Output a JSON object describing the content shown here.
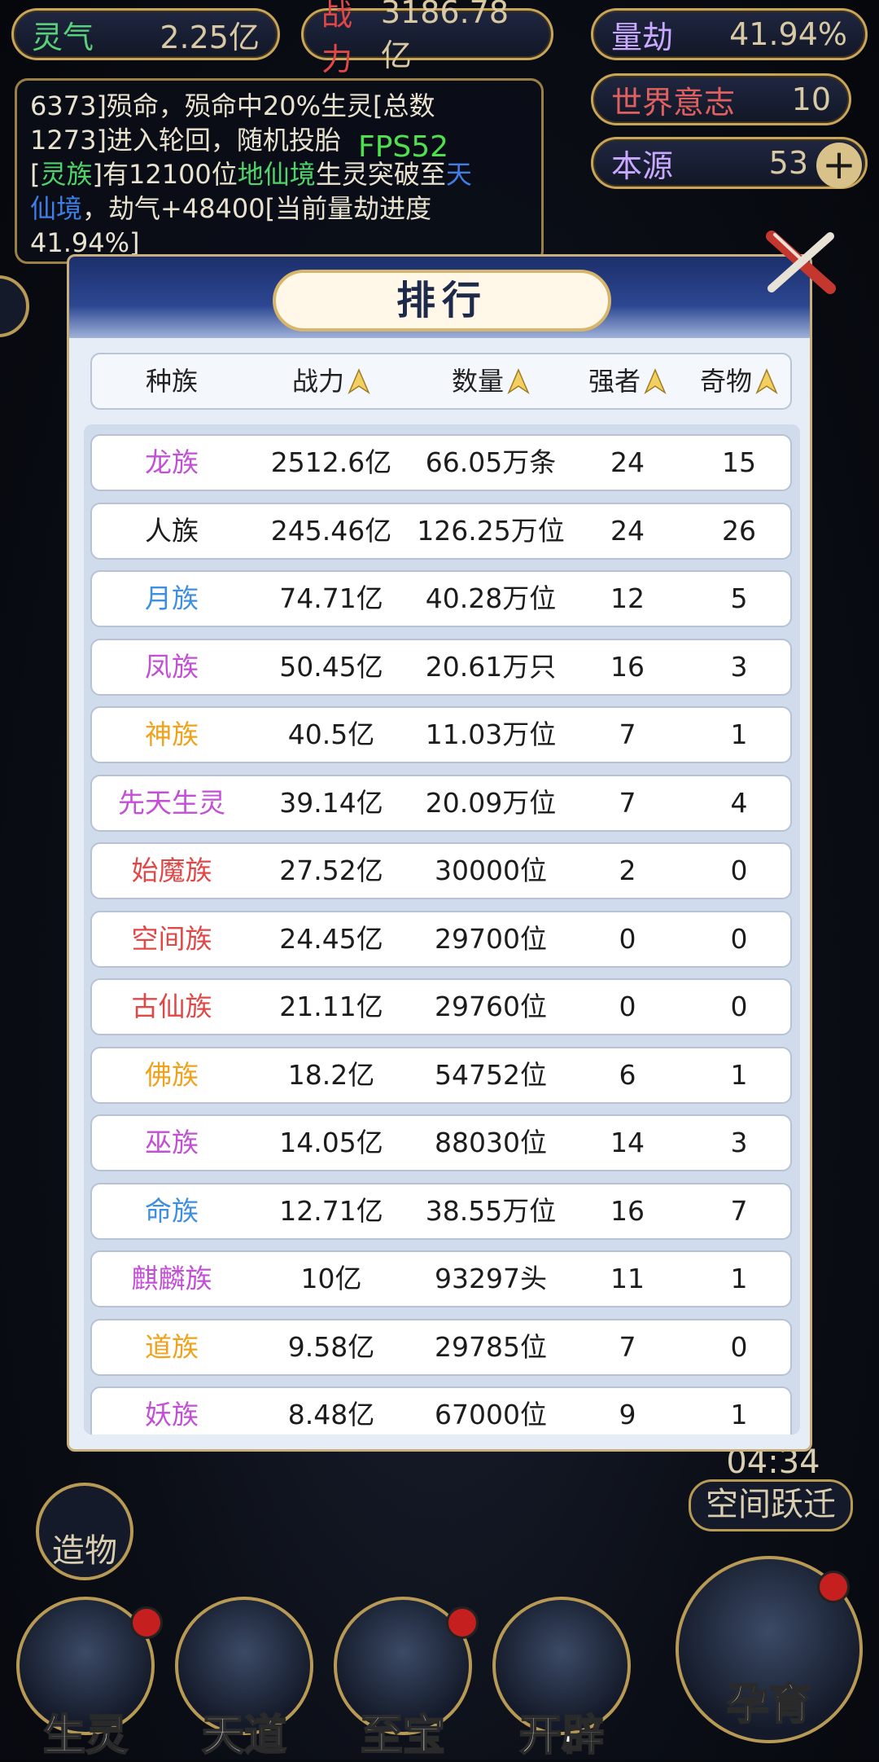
{
  "hud": {
    "lingqi_label": "灵气",
    "lingqi_value": "2.25亿",
    "zhanli_label": "战力",
    "zhanli_value": "3186.78亿",
    "liangjie_label": "量劫",
    "liangjie_value": "41.94%",
    "shijie_label": "世界意志",
    "shijie_value": "10",
    "benyuan_label": "本源",
    "benyuan_value": "53"
  },
  "log": {
    "line1": "6373]殒命，殒命中20%生灵[总数",
    "line2": "1273]进入轮回，随机投胎",
    "line3_a": "[",
    "line3_race": "灵族",
    "line3_b": "]有12100位",
    "line3_realm": "地仙境",
    "line3_c": "生灵突破至",
    "line3_realm2": "天",
    "line4_a": "仙境",
    "line4_b": "，劫气+48400[当前量劫进度",
    "line5": "41.94%]"
  },
  "fps": "FPS52",
  "modal": {
    "title": "排行",
    "columns": [
      "种族",
      "战力",
      "数量",
      "强者",
      "奇物"
    ],
    "rows": [
      {
        "name": "龙族",
        "power": "2512.6亿",
        "count": "66.05万条",
        "strong": "24",
        "item": "15",
        "color": "#c34fd6"
      },
      {
        "name": "人族",
        "power": "245.46亿",
        "count": "126.25万位",
        "strong": "24",
        "item": "26",
        "color": "#1c1c1c"
      },
      {
        "name": "月族",
        "power": "74.71亿",
        "count": "40.28万位",
        "strong": "12",
        "item": "5",
        "color": "#3d8fe0"
      },
      {
        "name": "凤族",
        "power": "50.45亿",
        "count": "20.61万只",
        "strong": "16",
        "item": "3",
        "color": "#c34fd6"
      },
      {
        "name": "神族",
        "power": "40.5亿",
        "count": "11.03万位",
        "strong": "7",
        "item": "1",
        "color": "#f0a21c"
      },
      {
        "name": "先天生灵",
        "power": "39.14亿",
        "count": "20.09万位",
        "strong": "7",
        "item": "4",
        "color": "#c34fd6"
      },
      {
        "name": "始魔族",
        "power": "27.52亿",
        "count": "30000位",
        "strong": "2",
        "item": "0",
        "color": "#e04848"
      },
      {
        "name": "空间族",
        "power": "24.45亿",
        "count": "29700位",
        "strong": "0",
        "item": "0",
        "color": "#e04848"
      },
      {
        "name": "古仙族",
        "power": "21.11亿",
        "count": "29760位",
        "strong": "0",
        "item": "0",
        "color": "#e04848"
      },
      {
        "name": "佛族",
        "power": "18.2亿",
        "count": "54752位",
        "strong": "6",
        "item": "1",
        "color": "#f0a21c"
      },
      {
        "name": "巫族",
        "power": "14.05亿",
        "count": "88030位",
        "strong": "14",
        "item": "3",
        "color": "#c34fd6"
      },
      {
        "name": "命族",
        "power": "12.71亿",
        "count": "38.55万位",
        "strong": "16",
        "item": "7",
        "color": "#3d8fe0"
      },
      {
        "name": "麒麟族",
        "power": "10亿",
        "count": "93297头",
        "strong": "11",
        "item": "1",
        "color": "#c34fd6"
      },
      {
        "name": "道族",
        "power": "9.58亿",
        "count": "29785位",
        "strong": "7",
        "item": "0",
        "color": "#f0a21c"
      },
      {
        "name": "妖族",
        "power": "8.48亿",
        "count": "67000位",
        "strong": "9",
        "item": "1",
        "color": "#c34fd6"
      }
    ]
  },
  "side": {
    "zaowu": "造物",
    "kongjian": "空间跃迁",
    "timer": "04:34"
  },
  "bottom": [
    "生灵",
    "天道",
    "至宝",
    "开辟",
    "孕育"
  ]
}
